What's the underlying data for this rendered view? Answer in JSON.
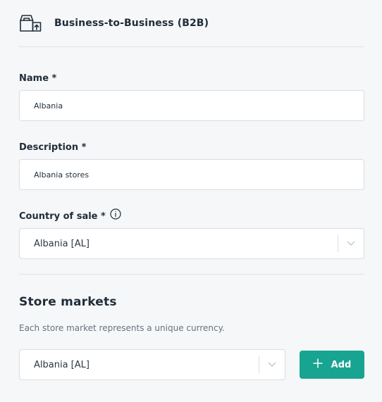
{
  "header": {
    "title": "Business-to-Business (B2B)",
    "icon": "box-upload-icon"
  },
  "form": {
    "name": {
      "label": "Name *",
      "value": "Albania"
    },
    "description": {
      "label": "Description *",
      "value": "Albania stores"
    },
    "country": {
      "label": "Country of sale *",
      "info_icon": "info-icon",
      "selected": "Albania [AL]"
    }
  },
  "store_markets": {
    "title": "Store markets",
    "description": "Each store market represents a unique currency.",
    "selected": "Albania [AL]",
    "add_label": "Add"
  },
  "colors": {
    "accent": "#17a491",
    "text": "#1f2d3a",
    "muted": "#67727c",
    "border": "#d8dde2"
  }
}
